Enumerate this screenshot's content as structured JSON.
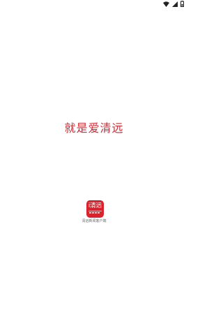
{
  "status_bar": {
    "icons": [
      "wifi-icon",
      "signal-icon",
      "battery-icon"
    ]
  },
  "splash": {
    "slogan": "就是爱清远",
    "app_icon_text": "i清远",
    "app_caption": "清远新闻客户端"
  },
  "colors": {
    "accent": "#d02a33",
    "icon_bg": "#d8222c",
    "background": "#ffffff"
  }
}
